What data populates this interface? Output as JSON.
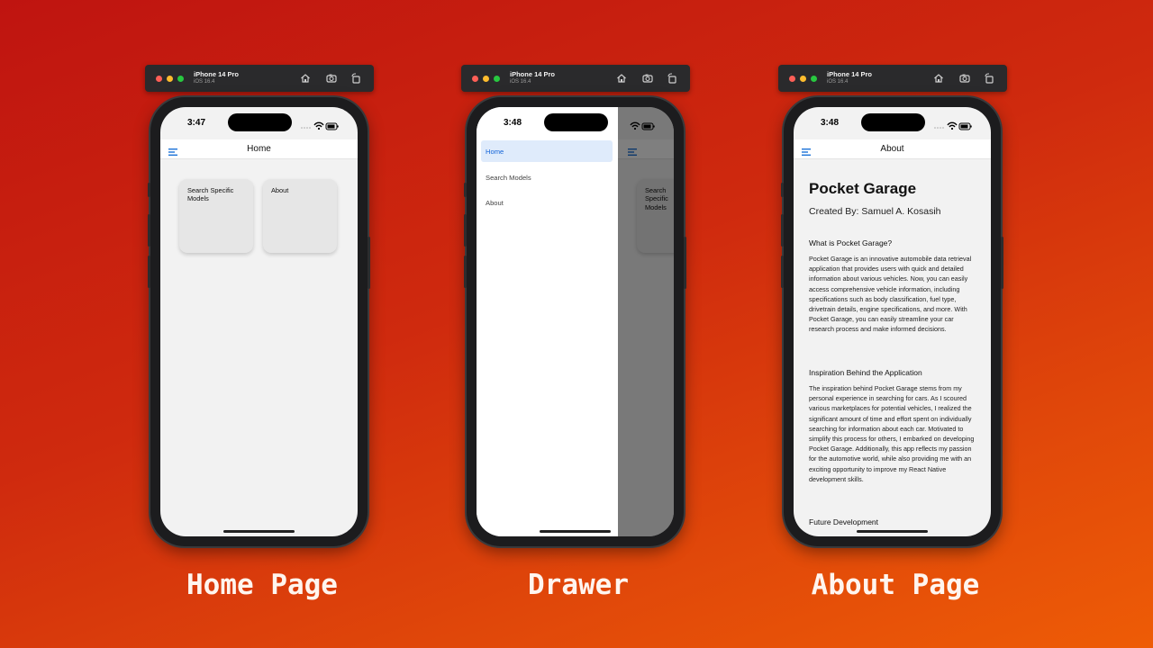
{
  "simulator": {
    "device": "iPhone 14 Pro",
    "os": "iOS 16.4",
    "icons": [
      "home-icon",
      "screenshot-icon",
      "rotate-icon"
    ]
  },
  "home_screen": {
    "time": "3:47",
    "header_title": "Home",
    "cards": [
      "Search Specific Models",
      "About"
    ],
    "caption": "Home Page"
  },
  "drawer_screen": {
    "time": "3:48",
    "items": [
      "Home",
      "Search Models",
      "About"
    ],
    "active_item": "Home",
    "peek_card": "Search Specific Models",
    "caption": "Drawer"
  },
  "about_screen": {
    "time": "3:48",
    "header_title": "About",
    "title": "Pocket Garage",
    "subtitle": "Created By: Samuel A. Kosasih",
    "sections": [
      {
        "heading": "What is Pocket Garage?",
        "body": "Pocket Garage is an innovative automobile data retrieval application that provides users with quick and detailed information about various vehicles. Now, you can easily access comprehensive vehicle information, including specifications such as body classification, fuel type, drivetrain details, engine specifications, and more. With Pocket Garage, you can easily streamline your car research process and make informed decisions."
      },
      {
        "heading": "Inspiration Behind the Application",
        "body": "The inspiration behind Pocket Garage stems from my personal experience in searching for cars. As I scoured various marketplaces for potential vehicles, I realized the significant amount of time and effort spent on individually searching for information about each car. Motivated to simplify this process for others, I embarked on developing Pocket Garage. Additionally, this app reflects my passion for the automotive world, while also providing me with an exciting opportunity to improve my React Native development skills."
      },
      {
        "heading": "Future Development",
        "body": ""
      }
    ],
    "caption": "About Page"
  },
  "colors": {
    "accent_blue": "#1565d8",
    "drawer_active_bg": "#dfebfb",
    "background_start": "#bf1410",
    "background_end": "#ee5c06"
  }
}
